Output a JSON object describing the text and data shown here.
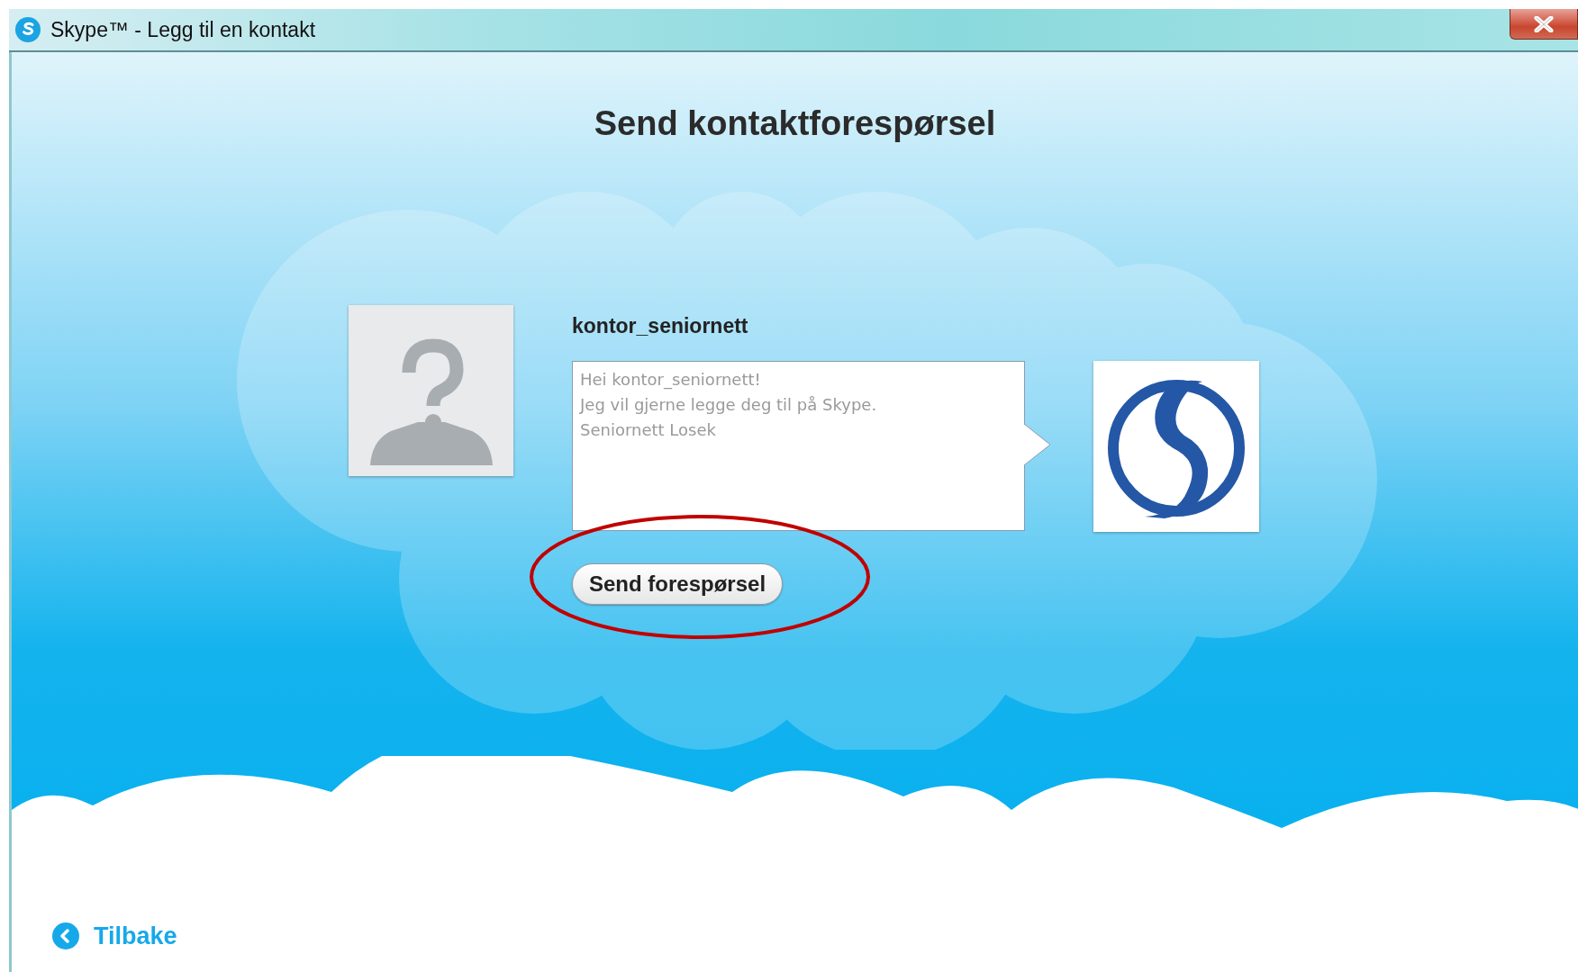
{
  "window": {
    "title": "Skype™ - Legg til en kontakt"
  },
  "heading": "Send kontaktforespørsel",
  "contact": {
    "username": "kontor_seniornett"
  },
  "message": {
    "value": "Hei kontor_seniornett!\nJeg vil gjerne legge deg til på Skype.\nSeniornett Losek"
  },
  "send_button": {
    "label": "Send forespørsel"
  },
  "back_link": {
    "label": "Tilbake"
  }
}
